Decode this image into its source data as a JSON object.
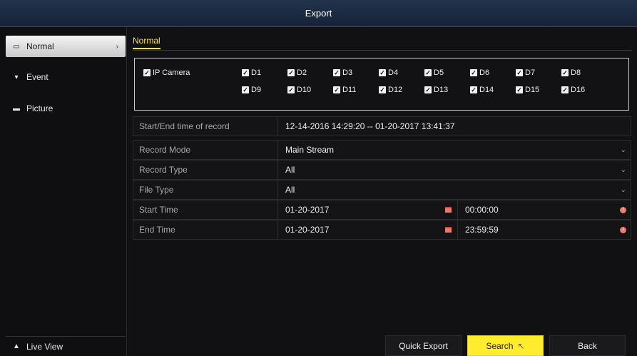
{
  "window": {
    "title": "Export"
  },
  "sidebar": {
    "items": [
      {
        "label": "Normal",
        "icon": "folder-icon",
        "active": true
      },
      {
        "label": "Event",
        "icon": "event-pin-icon",
        "active": false
      },
      {
        "label": "Picture",
        "icon": "picture-icon",
        "active": false
      }
    ],
    "live_view": "Live View"
  },
  "tabs": {
    "active": "Normal"
  },
  "cameras": {
    "group_label": "IP Camera",
    "row1": [
      "D1",
      "D2",
      "D3",
      "D4",
      "D5",
      "D6",
      "D7",
      "D8"
    ],
    "row2": [
      "D9",
      "D10",
      "D11",
      "D12",
      "D13",
      "D14",
      "D15",
      "D16"
    ]
  },
  "fields": {
    "record_range": {
      "label": "Start/End time of record",
      "value": "12-14-2016 14:29:20 -- 01-20-2017 13:41:37"
    },
    "record_mode": {
      "label": "Record Mode",
      "value": "Main Stream"
    },
    "record_type": {
      "label": "Record Type",
      "value": "All"
    },
    "file_type": {
      "label": "File Type",
      "value": "All"
    },
    "start_time": {
      "label": "Start Time",
      "date": "01-20-2017",
      "time": "00:00:00"
    },
    "end_time": {
      "label": "End Time",
      "date": "01-20-2017",
      "time": "23:59:59"
    }
  },
  "buttons": {
    "quick_export": "Quick Export",
    "search": "Search",
    "back": "Back"
  },
  "colors": {
    "accent": "#ffe14b",
    "titlebar": "#1b2a42"
  }
}
